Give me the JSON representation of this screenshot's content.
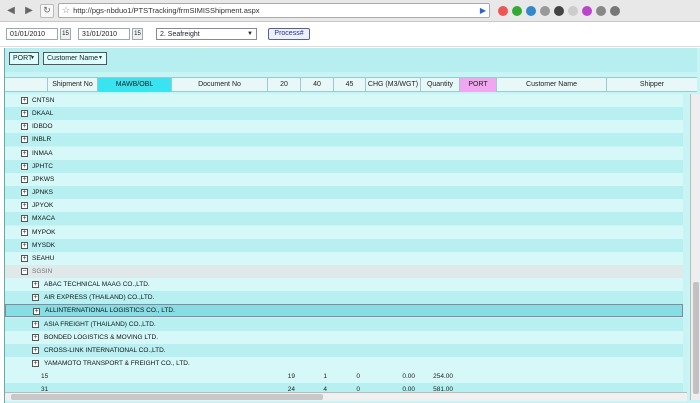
{
  "browser": {
    "url": "http://pgs-nbduo1/PTSTracking/frmSIMISShipment.aspx"
  },
  "filters": {
    "date_from": "01/01/2010",
    "date_to": "31/01/2010",
    "mode": "2. Seafreight",
    "process_label": "Process#"
  },
  "grouping": {
    "port_chip": "PORT",
    "customer_chip": "Customer Name"
  },
  "columns": [
    "Shipment No",
    "MAWB/OBL",
    "Document No",
    "20",
    "40",
    "45",
    "CHG (M3/WGT)",
    "Quantity",
    "PORT",
    "Customer Name",
    "Shipper"
  ],
  "port_groups": [
    "CNTSN",
    "DKAAL",
    "IDBDO",
    "INBLR",
    "INMAA",
    "JPHTC",
    "JPKWS",
    "JPNKS",
    "JPYOK",
    "MXACA",
    "MYPOK",
    "MYSDK",
    "SEAHU"
  ],
  "expanded_port": "SGSIN",
  "customers": [
    "ABAC TECHNICAL MAAG CO.,LTD.",
    "AIR EXPRESS (THAILAND) CO.,LTD.",
    "ALLINTERNATIONAL LOGISTICS CO., LTD.",
    "ASIA  FREIGHT (THAILAND) CO.,LTD.",
    "BONDED LOGISTICS & MOVING LTD.",
    "CROSS-LINK INTERNATIONAL CO.,LTD.",
    "YAMAMOTO TRANSPORT & FREIGHT CO., LTD."
  ],
  "summary_rows": [
    {
      "shipment": "15",
      "c20": "19",
      "c40": "1",
      "c45": "0",
      "chg": "0.00",
      "qty": "254.00"
    },
    {
      "shipment": "31",
      "c20": "24",
      "c40": "4",
      "c45": "0",
      "chg": "0.00",
      "qty": "581.00"
    }
  ],
  "colors": {
    "accent_mawb": "#39e3f0",
    "accent_port": "#f0a6f0",
    "grid_bg": "#c9f4f6"
  }
}
